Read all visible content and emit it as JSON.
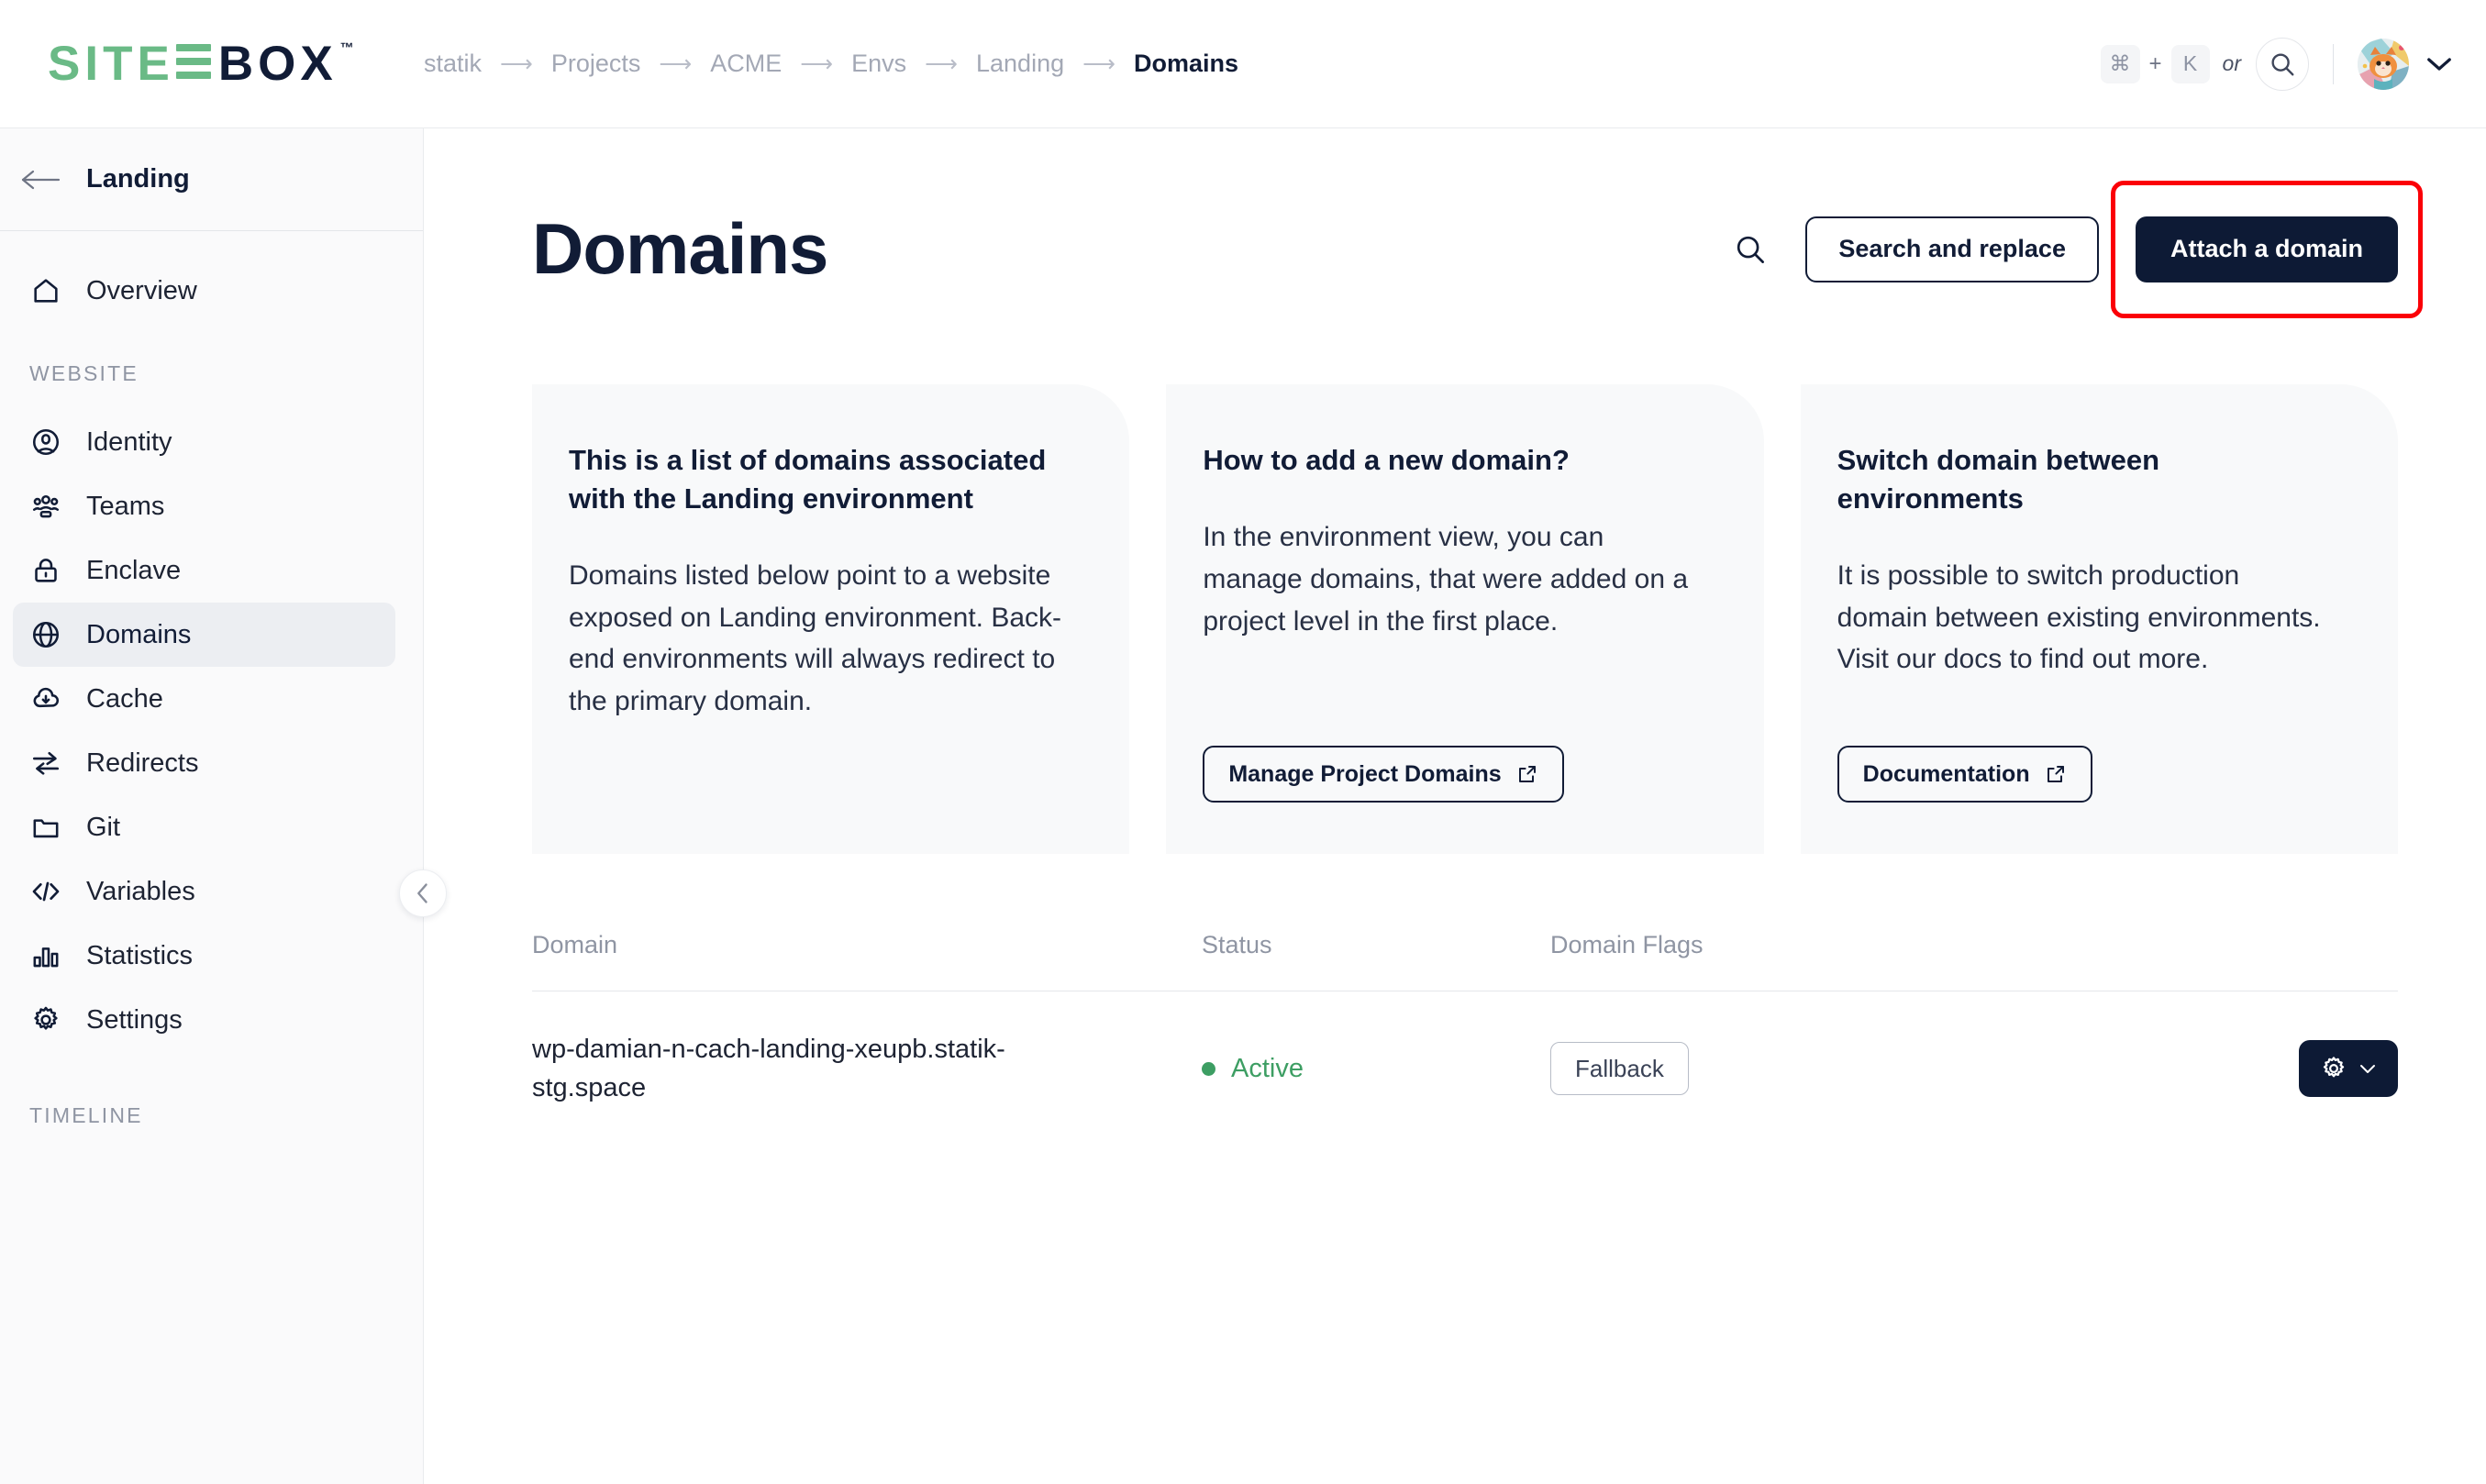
{
  "brand": {
    "name_part1": "SITE",
    "name_part2": "BOX",
    "trademark": "™",
    "green": "#6aba86",
    "navy": "#111c36"
  },
  "breadcrumb": {
    "items": [
      {
        "label": "statik",
        "current": false
      },
      {
        "label": "Projects",
        "current": false
      },
      {
        "label": "ACME",
        "current": false
      },
      {
        "label": "Envs",
        "current": false
      },
      {
        "label": "Landing",
        "current": false
      },
      {
        "label": "Domains",
        "current": true
      }
    ],
    "separator": "⟶"
  },
  "topbar": {
    "shortcut_key1": "⌘",
    "shortcut_plus": "+",
    "shortcut_key2": "K",
    "or_label": "or",
    "search_icon": "search-icon",
    "avatar_icon": "cat-avatar",
    "user_chevron_icon": "chevron-down-icon"
  },
  "sidebar": {
    "back_icon": "arrow-left-icon",
    "env_label": "Landing",
    "collapse_icon": "chevron-left-icon",
    "top_items": [
      {
        "label": "Overview",
        "icon": "home-icon",
        "active": false
      }
    ],
    "sections": [
      {
        "label": "WEBSITE",
        "items": [
          {
            "label": "Identity",
            "icon": "user-circle-icon",
            "active": false
          },
          {
            "label": "Teams",
            "icon": "people-icon",
            "active": false
          },
          {
            "label": "Enclave",
            "icon": "lock-icon",
            "active": false
          },
          {
            "label": "Domains",
            "icon": "globe-icon",
            "active": true
          },
          {
            "label": "Cache",
            "icon": "cloud-download-icon",
            "active": false
          },
          {
            "label": "Redirects",
            "icon": "arrows-swap-icon",
            "active": false
          },
          {
            "label": "Git",
            "icon": "folder-icon",
            "active": false
          },
          {
            "label": "Variables",
            "icon": "code-brackets-icon",
            "active": false
          },
          {
            "label": "Statistics",
            "icon": "bar-chart-icon",
            "active": false
          },
          {
            "label": "Settings",
            "icon": "gear-icon",
            "active": false
          }
        ]
      },
      {
        "label": "TIMELINE",
        "items": []
      }
    ]
  },
  "main": {
    "title": "Domains",
    "search_icon": "search-icon",
    "search_replace_label": "Search and replace",
    "attach_label": "Attach a domain",
    "highlight_color": "#fb0007",
    "cards": [
      {
        "title": "This is a list of domains associated with the Landing environment",
        "body": "Domains listed below point to a website exposed on Landing environment. Back-end environments will always redirect to the primary domain.",
        "button": null
      },
      {
        "title": "How to add a new domain?",
        "body": "In the environment view, you can manage domains, that were added on a project level in the first place.",
        "button": {
          "label": "Manage Project Domains",
          "icon": "external-link-icon"
        }
      },
      {
        "title": "Switch domain between environments",
        "body": "It is possible to switch production domain between existing environments. Visit our docs to find out more.",
        "button": {
          "label": "Documentation",
          "icon": "external-link-icon"
        }
      }
    ],
    "table": {
      "columns": [
        "Domain",
        "Status",
        "Domain Flags",
        ""
      ],
      "rows": [
        {
          "domain": "wp-damian-n-cach-landing-xeupb.statik-stg.space",
          "status": "Active",
          "status_color": "#3d9e63",
          "flags": [
            "Fallback"
          ],
          "action_icon": "gear-icon",
          "action_chevron": "chevron-down-icon"
        }
      ]
    }
  }
}
